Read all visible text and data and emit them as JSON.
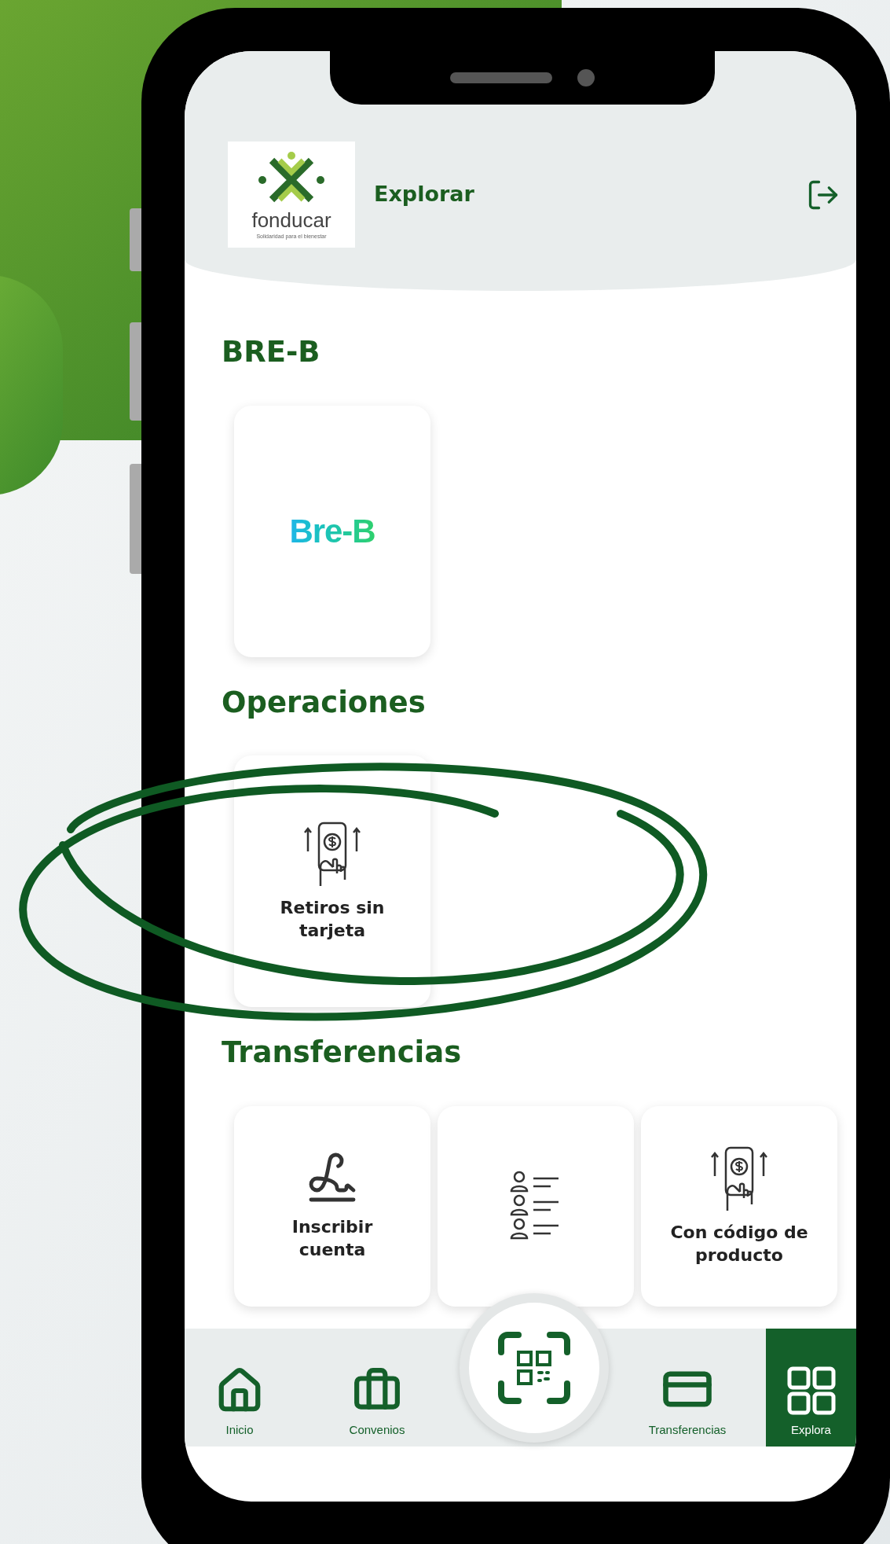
{
  "header": {
    "logo_name": "fonducar",
    "logo_tagline": "Solidaridad para el bienestar",
    "title": "Explorar"
  },
  "sections": [
    {
      "title": "BRE-B",
      "items": [
        {
          "kind": "brand",
          "label": "Bre-B"
        }
      ]
    },
    {
      "title": "Operaciones",
      "items": [
        {
          "kind": "cash-phone",
          "label": "Retiros sin tarjeta"
        }
      ]
    },
    {
      "title": "Transferencias",
      "items": [
        {
          "kind": "sign",
          "label": "Inscribir cuenta"
        },
        {
          "kind": "contacts"
        },
        {
          "kind": "cash-phone",
          "label": "Con código de producto"
        }
      ]
    }
  ],
  "nav": [
    {
      "kind": "home",
      "label": "Inicio",
      "selected": false
    },
    {
      "kind": "briefcase",
      "label": "Convenios",
      "selected": false
    },
    {
      "kind": "qr"
    },
    {
      "kind": "card",
      "label": "Transferencias",
      "selected": false
    },
    {
      "kind": "grid",
      "label": "Explora",
      "selected": true
    }
  ]
}
